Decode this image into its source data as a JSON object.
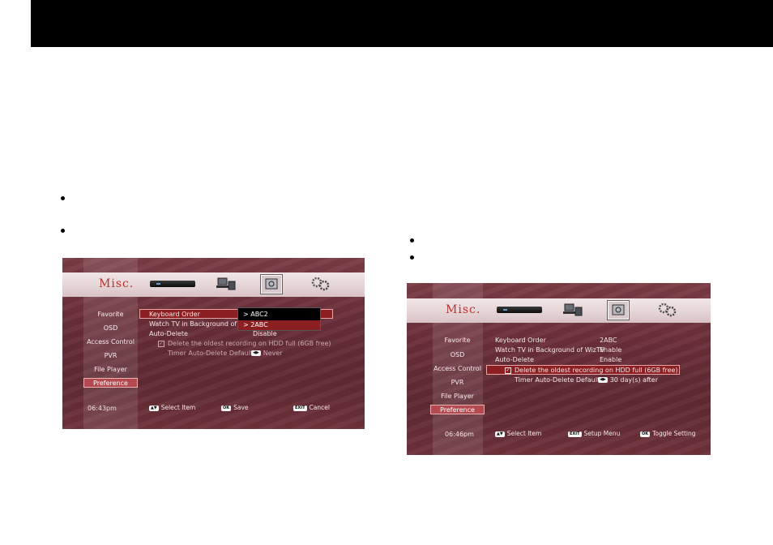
{
  "left": {
    "misc_title": "Misc.",
    "menu": [
      "Favorite",
      "OSD",
      "Access Control",
      "PVR",
      "File Player",
      "Preference"
    ],
    "active_menu": "Preference",
    "rows": {
      "keyboard_order": "Keyboard Order",
      "watch_tv": "Watch TV in Background of Wiz",
      "auto_delete": "Auto-Delete",
      "auto_delete_value": "Disable",
      "delete_oldest": "Delete the oldest recording on HDD full (6GB free)",
      "timer_auto_delete": "Timer Auto-Delete Default",
      "timer_value": "Never"
    },
    "dropdown": {
      "options": [
        "> ABC2",
        "> 2ABC"
      ],
      "selected": "> 2ABC"
    },
    "time": "06:43pm",
    "hints": {
      "select_key": "▲▼",
      "select": "Select Item",
      "save_key": "OK",
      "save": "Save",
      "cancel_key": "EXIT",
      "cancel": "Cancel"
    }
  },
  "right": {
    "misc_title": "Misc.",
    "menu": [
      "Favorite",
      "OSD",
      "Access Control",
      "PVR",
      "File Player",
      "Preference"
    ],
    "active_menu": "Preference",
    "rows": {
      "keyboard_order": "Keyboard Order",
      "keyboard_order_value": "2ABC",
      "watch_tv": "Watch TV in Background of WizTV",
      "watch_tv_value": "Enable",
      "auto_delete": "Auto-Delete",
      "auto_delete_value": "Enable",
      "delete_oldest": "Delete the oldest recording on HDD full (6GB free)",
      "timer_auto_delete": "Timer Auto-Delete Default",
      "timer_value": "30 day(s) after"
    },
    "time": "06:46pm",
    "hints": {
      "select_key": "▲▼",
      "select": "Select Item",
      "setup_key": "EXIT",
      "setup": "Setup Menu",
      "toggle_key": "OK",
      "toggle": "Toggle Setting"
    }
  },
  "colors": {
    "screen_background": "#6a2f39",
    "highlight": "#8c1f22",
    "active_menu": "#b44a4f",
    "misc_title": "#b8322e"
  }
}
